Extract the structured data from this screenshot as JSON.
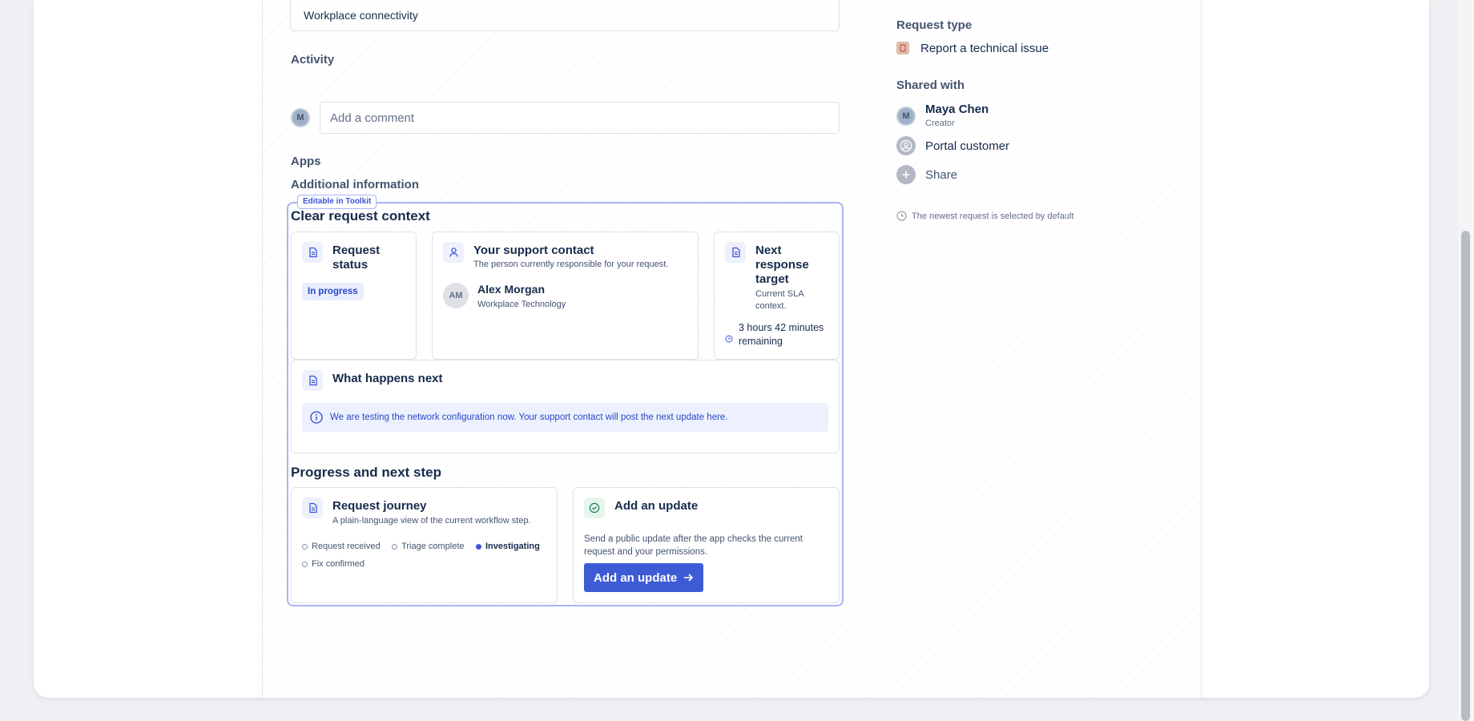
{
  "main": {
    "summary_value": "Workplace connectivity",
    "activity_label": "Activity",
    "comment": {
      "avatar_initial": "M",
      "placeholder": "Add a comment"
    },
    "apps_label": "Apps",
    "additional_info_label": "Additional information",
    "toolkit_badge": "Editable in Toolkit",
    "context_title": "Clear request context",
    "request_status": {
      "title": "Request status",
      "status": "In progress"
    },
    "support_contact": {
      "title": "Your support contact",
      "subtitle": "The person currently responsible for your request.",
      "initials": "AM",
      "name": "Alex Morgan",
      "team": "Workplace Technology"
    },
    "next_response": {
      "title": "Next response target",
      "subtitle": "Current SLA context.",
      "remaining": "3 hours 42 minutes remaining"
    },
    "what_next": {
      "title": "What happens next",
      "message": "We are testing the network configuration now. Your support contact will post the next update here."
    },
    "progress_title": "Progress and next step",
    "journey": {
      "title": "Request journey",
      "subtitle": "A plain-language view of the current workflow step.",
      "steps": [
        {
          "label": "Request received",
          "active": false
        },
        {
          "label": "Triage complete",
          "active": false
        },
        {
          "label": "Investigating",
          "active": true
        },
        {
          "label": "Fix confirmed",
          "active": false
        }
      ]
    },
    "add_update": {
      "title": "Add an update",
      "description": "Send a public update after the app checks the current request and your permissions.",
      "button_label": "Add an update"
    }
  },
  "sidebar": {
    "request_type_label": "Request type",
    "request_type_value": "Report a technical issue",
    "shared_with_label": "Shared with",
    "people": [
      {
        "initial": "M",
        "name": "Maya Chen",
        "role": "Creator"
      }
    ],
    "portal_customer": "Portal customer",
    "share_label": "Share",
    "footnote": "The newest request is selected by default"
  },
  "colors": {
    "primary": "#3e5bd6",
    "badge_border": "#a9b4f2",
    "info_bg": "#edf1fe",
    "lozenge_bg": "#e9edfd"
  }
}
